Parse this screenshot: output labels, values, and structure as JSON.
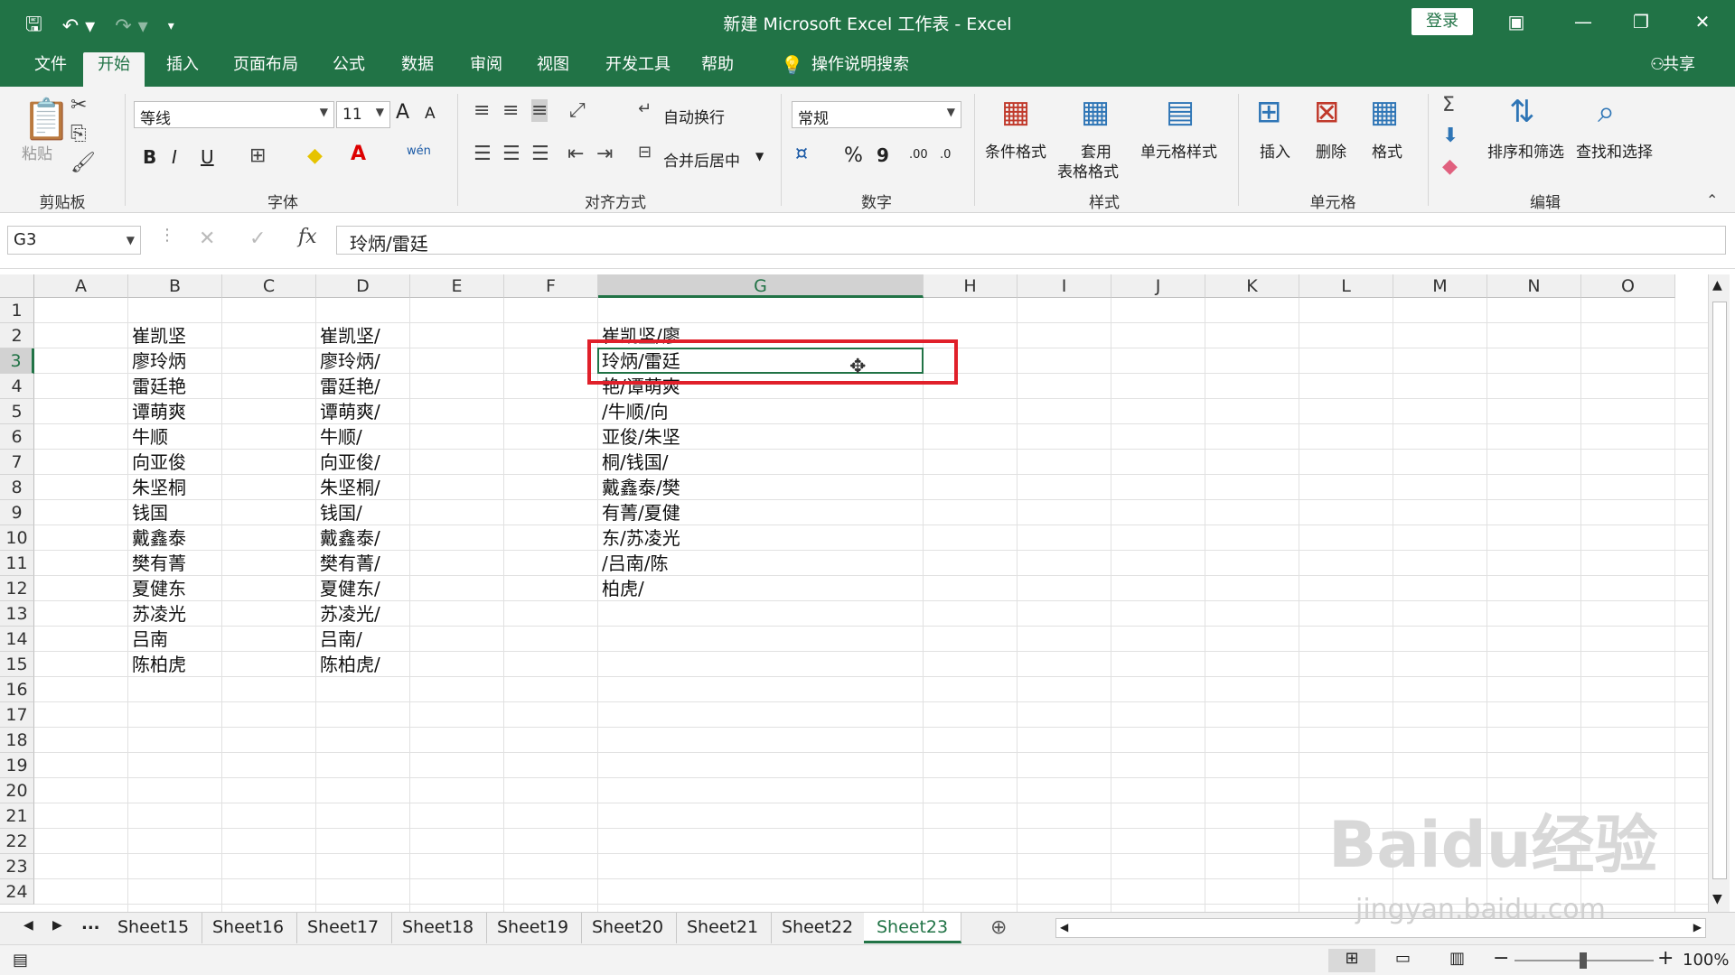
{
  "window": {
    "title": "新建 Microsoft Excel 工作表  -  Excel",
    "login_label": "登录",
    "share_label": "共享",
    "accent": "#217346"
  },
  "tabs": [
    {
      "label": "文件",
      "active": false
    },
    {
      "label": "开始",
      "active": true
    },
    {
      "label": "插入",
      "active": false
    },
    {
      "label": "页面布局",
      "active": false
    },
    {
      "label": "公式",
      "active": false
    },
    {
      "label": "数据",
      "active": false
    },
    {
      "label": "审阅",
      "active": false
    },
    {
      "label": "视图",
      "active": false
    },
    {
      "label": "开发工具",
      "active": false
    },
    {
      "label": "帮助",
      "active": false
    }
  ],
  "tell_me": "操作说明搜索",
  "ribbon": {
    "clipboard": {
      "paste": "粘贴",
      "label": "剪贴板"
    },
    "font": {
      "name": "等线",
      "size": "11",
      "bold": "B",
      "italic": "I",
      "underline": "U",
      "label": "字体",
      "grow": "A",
      "shrink": "A",
      "phonetic": "wén"
    },
    "alignment": {
      "wrap": "自动换行",
      "merge": "合并后居中",
      "label": "对齐方式"
    },
    "number": {
      "format": "常规",
      "percent": "%",
      "comma": "9",
      "label": "数字",
      "inc_decimal": ".00",
      "dec_decimal": ".0"
    },
    "styles": {
      "conditional": "条件格式",
      "table_line1": "套用",
      "table_line2": "表格格式",
      "cell_styles": "单元格样式",
      "label": "样式"
    },
    "cells": {
      "insert": "插入",
      "delete": "删除",
      "format": "格式",
      "label": "单元格"
    },
    "editing": {
      "sort": "排序和筛选",
      "find": "查找和选择",
      "label": "编辑"
    }
  },
  "formula_bar": {
    "name_box": "G3",
    "formula": "玲炳/雷廷"
  },
  "columns": [
    "A",
    "B",
    "C",
    "D",
    "E",
    "F",
    "G",
    "H",
    "I",
    "J",
    "K",
    "L",
    "M",
    "N",
    "O"
  ],
  "selected_column": "G",
  "rows": [
    "1",
    "2",
    "3",
    "4",
    "5",
    "6",
    "7",
    "8",
    "9",
    "10",
    "11",
    "12",
    "13",
    "14",
    "15",
    "16",
    "17",
    "18",
    "19",
    "20",
    "21",
    "22",
    "23",
    "24"
  ],
  "selected_row": "3",
  "col_b": [
    "崔凯坚",
    "廖玲炳",
    "雷廷艳",
    "谭萌爽",
    "牛顺",
    "向亚俊",
    "朱坚桐",
    "钱国",
    "戴鑫泰",
    "樊有菁",
    "夏健东",
    "苏凌光",
    "吕南",
    "陈柏虎"
  ],
  "col_d": [
    "崔凯坚/",
    "廖玲炳/",
    "雷廷艳/",
    "谭萌爽/",
    "牛顺/",
    "向亚俊/",
    "朱坚桐/",
    "钱国/",
    "戴鑫泰/",
    "樊有菁/",
    "夏健东/",
    "苏凌光/",
    "吕南/",
    "陈柏虎/"
  ],
  "col_g": [
    "崔凯坚/廖",
    "玲炳/雷廷",
    "艳/谭萌爽",
    "/牛顺/向",
    "亚俊/朱坚",
    "桐/钱国/",
    "戴鑫泰/樊",
    "有菁/夏健",
    "东/苏凌光",
    "/吕南/陈",
    "柏虎/"
  ],
  "sheets": [
    "Sheet15",
    "Sheet16",
    "Sheet17",
    "Sheet18",
    "Sheet19",
    "Sheet20",
    "Sheet21",
    "Sheet22",
    "Sheet23"
  ],
  "active_sheet": "Sheet23",
  "sheet_more": "...",
  "status": {
    "zoom": "100%"
  },
  "watermark": {
    "main": "Baidu经验",
    "sub": "jingyan.baidu.com"
  },
  "highlight_color": "#e0202a"
}
